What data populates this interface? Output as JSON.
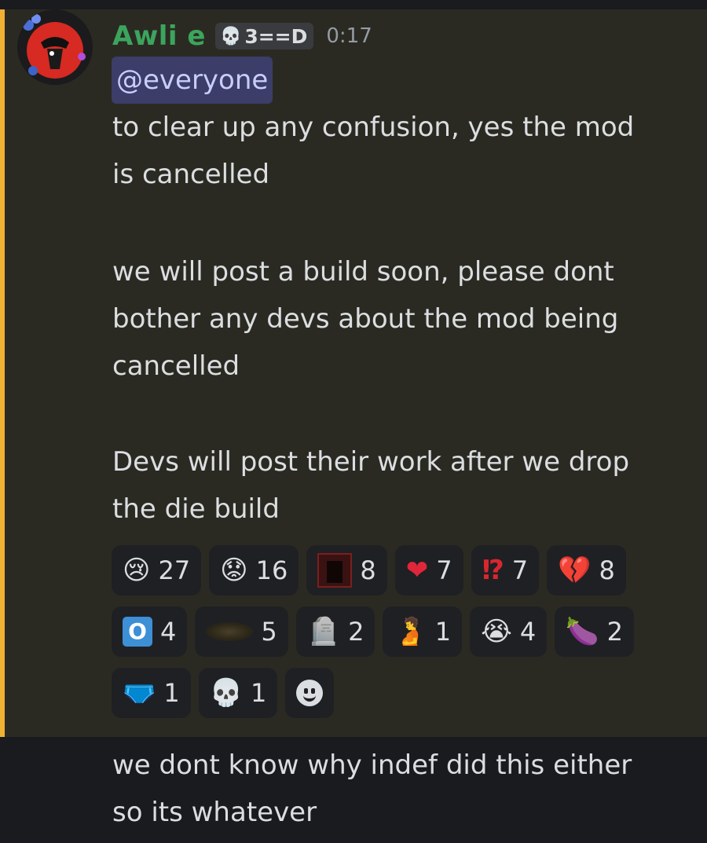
{
  "message": {
    "author": "Awli e",
    "tag_label": "3==D",
    "tag_icon": "skull-icon",
    "timestamp": "0:17",
    "mention": "@everyone",
    "lines": [
      "to clear up any confusion, yes the mod",
      "is cancelled",
      "we will post a build soon, please dont",
      "bother any devs about the mod being",
      "cancelled",
      "Devs will post their work after we drop",
      "the die build"
    ],
    "accent_color": "#f0b232",
    "username_color": "#3ba55d"
  },
  "reactions": [
    {
      "emoji": "😢",
      "icon": "crying-face-emoji",
      "count": "27"
    },
    {
      "emoji": "😟",
      "icon": "worried-face-emoji",
      "count": "16"
    },
    {
      "emoji": "",
      "icon": "custom-dark-image-emoji",
      "count": "8"
    },
    {
      "emoji": "❤",
      "icon": "red-heart-emoji",
      "count": "7"
    },
    {
      "emoji": "⁉",
      "icon": "interrobang-emoji",
      "count": "7"
    },
    {
      "emoji": "💔",
      "icon": "broken-heart-emoji",
      "count": "8"
    },
    {
      "emoji": "O",
      "icon": "o-button-emoji",
      "count": "4"
    },
    {
      "emoji": "",
      "icon": "custom-smudge-emoji",
      "count": "5"
    },
    {
      "emoji": "🪦",
      "icon": "headstone-emoji",
      "count": "2"
    },
    {
      "emoji": "🫄",
      "icon": "pregnant-person-emoji",
      "count": "1"
    },
    {
      "emoji": "😭",
      "icon": "loudly-crying-face-emoji",
      "count": "4"
    },
    {
      "emoji": "🍆",
      "icon": "eggplant-emoji",
      "count": "2"
    },
    {
      "emoji": "🩲",
      "icon": "briefs-emoji",
      "count": "1"
    },
    {
      "emoji": "💀",
      "icon": "skull-emoji",
      "count": "1"
    }
  ],
  "followup": {
    "lines": [
      "we dont know why indef did this either",
      "so its whatever"
    ]
  }
}
